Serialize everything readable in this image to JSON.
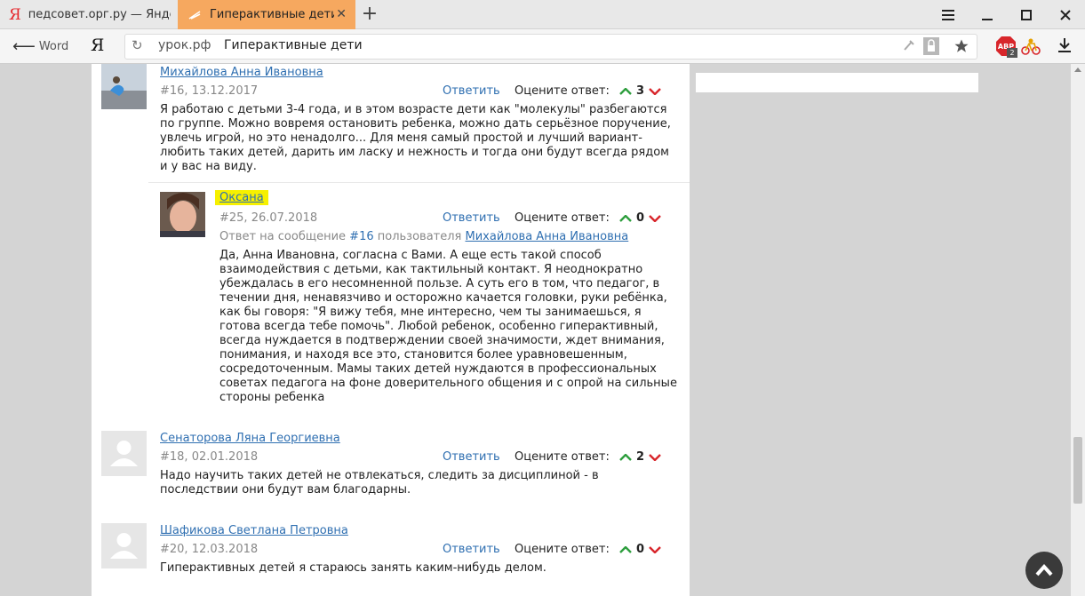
{
  "tabs": [
    {
      "label": "педсовет.орг.ру — Яндекс"
    },
    {
      "label": "Гиперактивные дети"
    }
  ],
  "nav": {
    "back_label": "Word",
    "yandex_logo": "Я",
    "domain": "урок.рф",
    "page_title": "Гиперактивные дети",
    "abp_badge": "2"
  },
  "rate_label": "Оцените ответ:",
  "reply_label": "Ответить",
  "comments": [
    {
      "author": "Михайлова Анна Ивановна",
      "meta": "#16, 13.12.2017",
      "score": "3",
      "text": "Я работаю с детьми 3-4 года, и в этом возрасте дети как \"молекулы\" разбегаются по группе. Можно вовремя остановить ребенка, можно дать серьёзное поручение, увлечь игрой, но это ненадолго... Для меня самый простой и лучший вариант- любить таких детей, дарить им ласку и нежность и тогда они будут всегда рядом и у вас на виду."
    },
    {
      "author": "Оксана",
      "meta": "#25, 26.07.2018",
      "score": "0",
      "reply_prefix": "Ответ на сообщение ",
      "reply_ref": "#16",
      "reply_mid": " пользователя ",
      "reply_user": "Михайлова Анна Ивановна",
      "text": "Да, Анна Ивановна, согласна с Вами. А еще есть такой способ взаимодействия с детьми, как тактильный контакт. Я неоднократно убеждалась в его несомненной пользе. А суть его в том, что педагог, в течении дня, ненавязчиво и осторожно качается головки, руки ребёнка, как бы говоря: \"Я вижу тебя, мне интересно, чем ты занимаешься, я готова всегда тебе помочь\". Любой ребенок, особенно гиперактивный, всегда нуждается в подтверждении своей значимости, ждет внимания, понимания, и находя все это, становится более уравновешенным, сосредоточенным. Мамы таких детей нуждаются в профессиональных советах педагога на фоне доверительного общения и с опрой на сильные стороны ребенка"
    },
    {
      "author": "Сенаторова Ляна Георгиевна",
      "meta": "#18, 02.01.2018",
      "score": "2",
      "text": "Надо научить таких детей не отвлекаться, следить за дисциплиной - в последствии они будут вам благодарны."
    },
    {
      "author": "Шафикова Светлана Петровна",
      "meta": "#20, 12.03.2018",
      "score": "0",
      "text": "Гиперактивных детей я стараюсь занять каким-нибудь делом."
    }
  ],
  "colors": {
    "up": "#2e9e3e",
    "down": "#d8262b",
    "link": "#2f6fb1",
    "active_tab": "#f6a85f",
    "highlight": "#f6f000"
  }
}
